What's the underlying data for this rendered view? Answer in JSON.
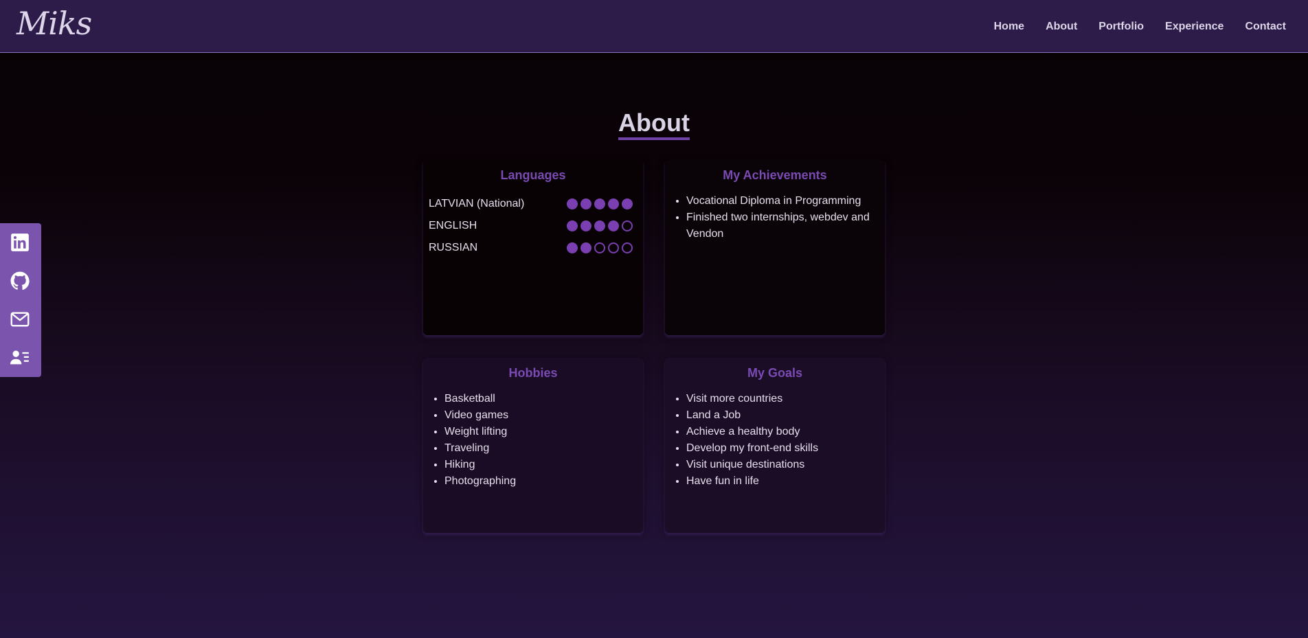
{
  "navbar": {
    "logo": "Miks",
    "links": [
      "Home",
      "About",
      "Portfolio",
      "Experience",
      "Contact"
    ]
  },
  "section": {
    "title": "About"
  },
  "languages": {
    "title": "Languages",
    "items": [
      {
        "name": "LATVIAN (National)",
        "level": 5,
        "max": 5
      },
      {
        "name": "ENGLISH",
        "level": 4,
        "max": 5
      },
      {
        "name": "RUSSIAN",
        "level": 2,
        "max": 5
      }
    ]
  },
  "achievements": {
    "title": "My Achievements",
    "items": [
      "Vocational Diploma in Programming",
      "Finished two internships, webdev and Vendon"
    ]
  },
  "hobbies": {
    "title": "Hobbies",
    "items": [
      "Basketball",
      "Video games",
      "Weight lifting",
      "Traveling",
      "Hiking",
      "Photographing"
    ]
  },
  "goals": {
    "title": "My Goals",
    "items": [
      "Visit more countries",
      "Land a Job",
      "Achieve a healthy body",
      "Develop my front-end skills",
      "Visit unique destinations",
      "Have fun in life"
    ]
  },
  "social": {
    "icons": [
      "linkedin-icon",
      "github-icon",
      "mail-icon",
      "contact-card-icon"
    ]
  },
  "colors": {
    "accent": "#7a4bb3",
    "navbar_bg": "#2d1b4a",
    "social_bg": "#7b55ad"
  }
}
